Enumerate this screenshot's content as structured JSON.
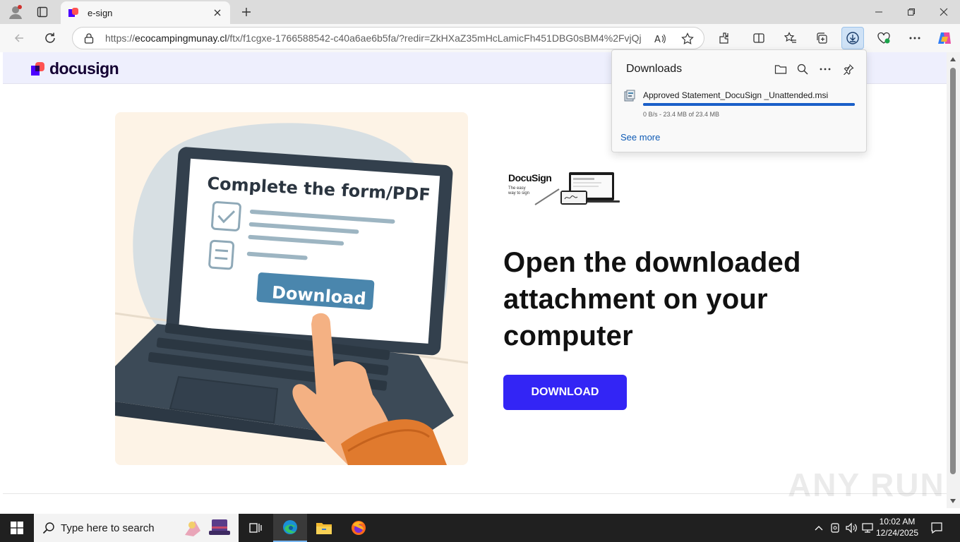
{
  "browser": {
    "tab_title": "e-sign",
    "url_prefix": "https://",
    "url_host": "ecocampingmunay.cl",
    "url_rest": "/ftx/f1cgxe-1766588542-c40a6ae6b5fa/?redir=ZkHXaZ35mHcLamicFh451DBG0sBM4%2FvjQj..."
  },
  "downloads": {
    "title": "Downloads",
    "file_name": "Approved Statement_DocuSign _Unattended.msi",
    "status": "0 B/s - 23.4 MB of 23.4 MB",
    "progress": 1.0,
    "see_more": "See more"
  },
  "page": {
    "brand": "docusign",
    "hero": {
      "screen_title": "Complete the form/PDF",
      "screen_button": "Download"
    },
    "small_logo": {
      "brand": "DocuSign",
      "tagline": "The easy way to sign"
    },
    "headline": "Open the downloaded attachment on your computer",
    "download_button": "DOWNLOAD"
  },
  "watermark": "ANY RUN",
  "taskbar": {
    "search_placeholder": "Type here to search",
    "time": "10:02 AM",
    "date": "12/24/2025"
  },
  "colors": {
    "accent_button": "#3325f5",
    "header_bg": "#eeeffd",
    "progress": "#1a5fc8"
  }
}
